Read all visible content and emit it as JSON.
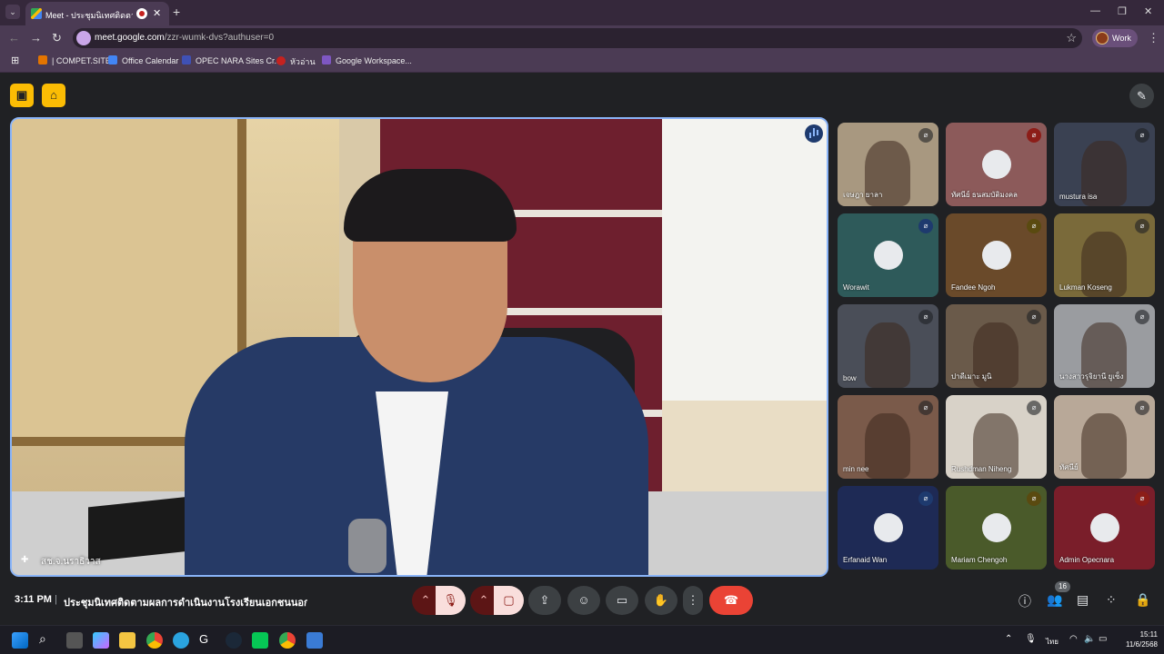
{
  "browser": {
    "tab_title": "Meet - ประชุมนิเทศติดตามผลการ",
    "tab_close": "✕",
    "new_tab": "+",
    "url_main": "meet.google.com",
    "url_path": "/zzr-wumk-dvs?authuser=0",
    "profile_label": "Work",
    "bookmarks": [
      {
        "label": "| COMPET.SITE",
        "color": "#e37400"
      },
      {
        "label": "Office Calendar",
        "color": "#4285f4"
      },
      {
        "label": "OPEC NARA Sites Cr...",
        "color": "#3f51b5"
      },
      {
        "label": "หัวอ่าน",
        "color": "#c5221f"
      },
      {
        "label": "Google Workspace...",
        "color": "#7e57c2"
      }
    ]
  },
  "meet": {
    "main_speaker": "สช.จ.นราธิวาส",
    "time": "3:11 PM",
    "separator": "|",
    "meeting_title": "ประชุมนิเทศติดตามผลการดำเนินงานโรงเรียนเอกชนนอกระบ...",
    "participant_count": "16",
    "tiles": [
      {
        "name": "เจษฎา ยาลา",
        "bg": "#a89880",
        "avatar": false,
        "mic": "off-gray"
      },
      {
        "name": "ทัศนีย์ ธนสมบัติมงคล",
        "bg": "#8c5a5a",
        "avatar": true,
        "mic": "off-red"
      },
      {
        "name": "mustura isa",
        "bg": "#3a4152",
        "avatar": false,
        "mic": "off-gray"
      },
      {
        "name": "Worawit",
        "bg": "#2e5a5a",
        "avatar": true,
        "mic": "off-blue"
      },
      {
        "name": "Fandee Ngoh",
        "bg": "#6a4a2a",
        "avatar": true,
        "mic": "off-gold"
      },
      {
        "name": "Lukman Koseng",
        "bg": "#7a6a3a",
        "avatar": false,
        "mic": "off-gray"
      },
      {
        "name": "bow",
        "bg": "#4a4e58",
        "avatar": false,
        "mic": "off-gray"
      },
      {
        "name": "ปาดีเมาะ มูนิ",
        "bg": "#6a5a4a",
        "avatar": false,
        "mic": "off-gray"
      },
      {
        "name": "นางสาวรุจิยานี ยูเซ็ง",
        "bg": "#9a9ca0",
        "avatar": false,
        "mic": "off-gray"
      },
      {
        "name": "min nee",
        "bg": "#7a5a4a",
        "avatar": false,
        "mic": "off-gray"
      },
      {
        "name": "Rushdman Niheng",
        "bg": "#d8d2c8",
        "avatar": false,
        "mic": "off-gray"
      },
      {
        "name": "ทัศนีย์",
        "bg": "#b8a898",
        "avatar": false,
        "mic": "off-gray"
      },
      {
        "name": "Erfanaid Wan",
        "bg": "#1e2a55",
        "avatar": true,
        "mic": "off-blue"
      },
      {
        "name": "Mariam Chengoh",
        "bg": "#4a5a2a",
        "avatar": true,
        "mic": "off-gold"
      },
      {
        "name": "Admin Opecnara",
        "bg": "#7a1e2a",
        "avatar": true,
        "mic": "off-red"
      }
    ]
  },
  "taskbar": {
    "time": "15:11",
    "date": "11/6/2568",
    "lang": "ไทย"
  }
}
